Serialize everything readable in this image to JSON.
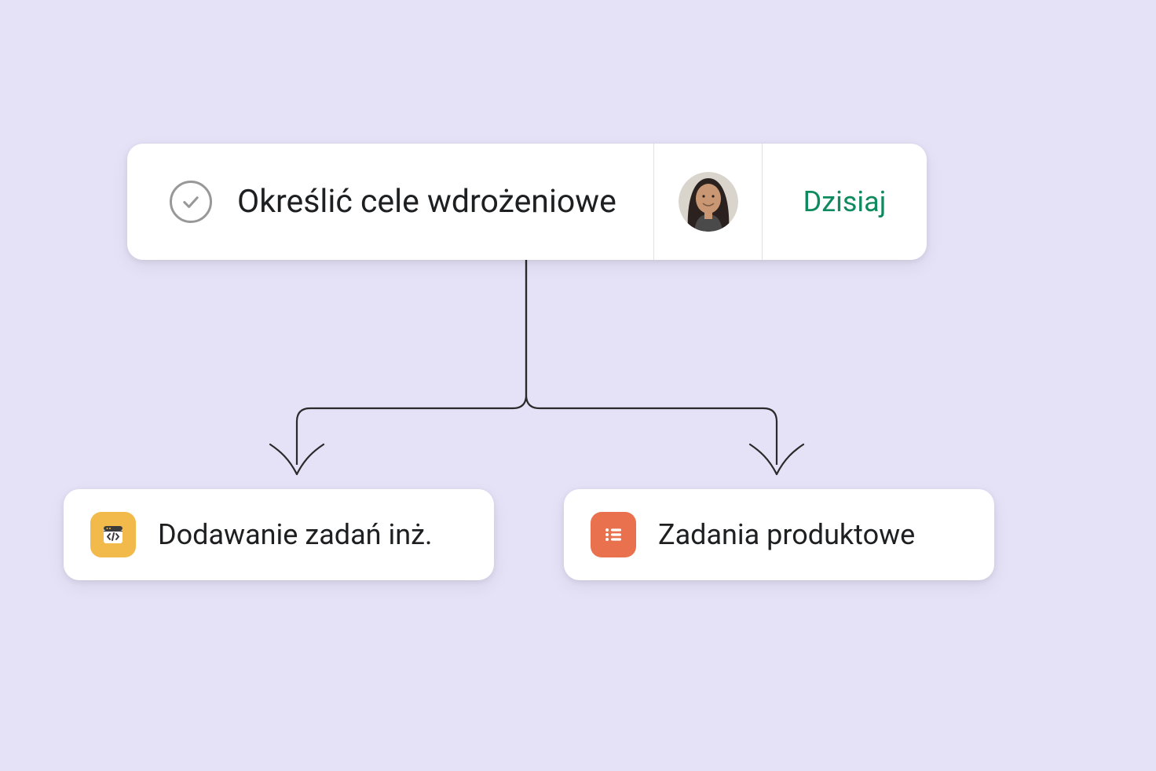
{
  "parent": {
    "title": "Określić cele wdrożeniowe",
    "date_label": "Dzisiaj"
  },
  "children": {
    "left": {
      "title": "Dodawanie zadań inż."
    },
    "right": {
      "title": "Zadania produktowe"
    }
  }
}
